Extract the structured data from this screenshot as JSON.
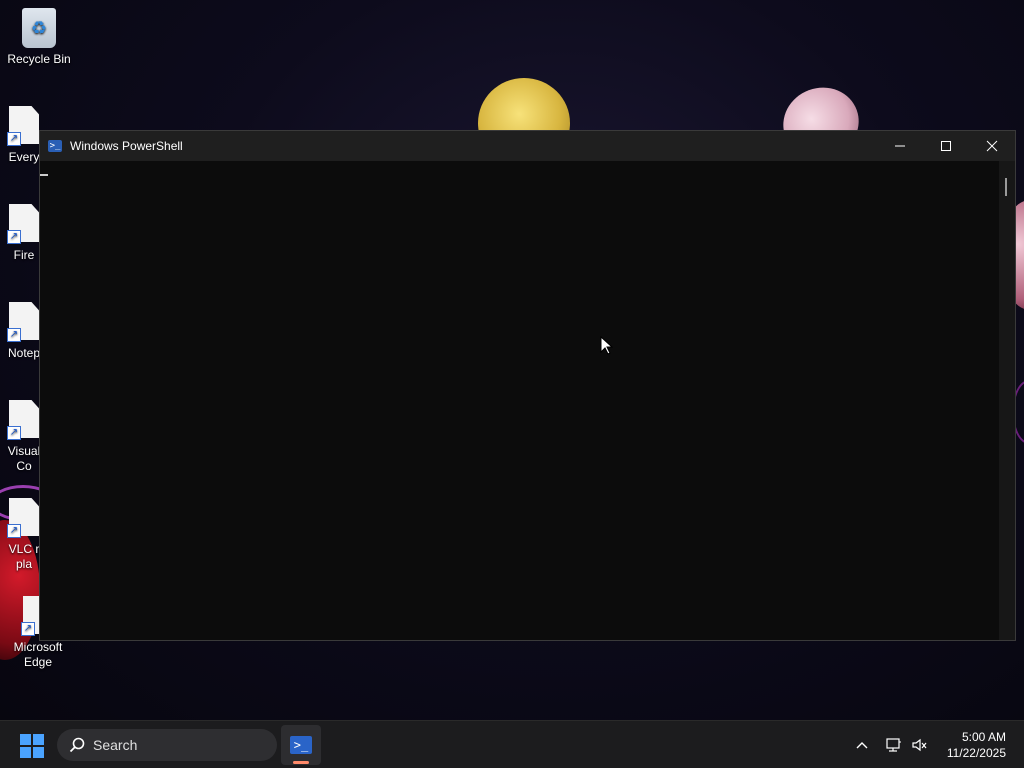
{
  "desktop": {
    "icons": [
      {
        "label": "Recycle Bin"
      },
      {
        "label": "Every"
      },
      {
        "label": "Fire"
      },
      {
        "label": "Notep"
      },
      {
        "label": "Visual",
        "label2": "Co"
      },
      {
        "label": "VLC r",
        "label2": "pla"
      },
      {
        "label": "Microsoft",
        "label2": "Edge"
      }
    ]
  },
  "window": {
    "title": "Windows PowerShell",
    "icon": "powershell-icon",
    "buttons": {
      "minimize": "–",
      "maximize": "☐",
      "close": "✕"
    }
  },
  "taskbar": {
    "search_placeholder": "Search",
    "pinned": [
      {
        "name": "Windows PowerShell",
        "icon": "powershell-icon",
        "active": true
      }
    ],
    "tray": {
      "chevron": "^",
      "network_icon": "network-icon",
      "volume_icon": "volume-muted-icon"
    },
    "time": "5:00 AM",
    "date": "11/22/2025"
  },
  "colors": {
    "accent": "#4aa3ff",
    "console_bg": "#0c0c0c",
    "active_indicator": "#ff8a6a"
  }
}
